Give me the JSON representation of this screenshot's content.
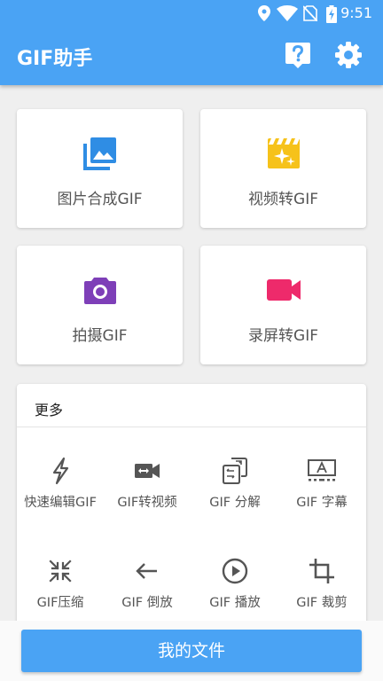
{
  "status_bar": {
    "time": "9:51",
    "icons": [
      "location-icon",
      "wifi-icon",
      "no-sim-icon",
      "battery-charging-icon"
    ]
  },
  "app_bar": {
    "title": "GIF助手",
    "help_icon": "help-icon",
    "settings_icon": "gear-icon"
  },
  "features": [
    {
      "label": "图片合成GIF",
      "icon": "photo-library-icon",
      "color": "#2f8de4"
    },
    {
      "label": "视频转GIF",
      "icon": "movie-clapper-icon",
      "color": "#f6c21a"
    },
    {
      "label": "拍摄GIF",
      "icon": "camera-icon",
      "color": "#7e3fb8"
    },
    {
      "label": "录屏转GIF",
      "icon": "video-camera-icon",
      "color": "#ee2a6b"
    }
  ],
  "more": {
    "title": "更多",
    "tools": [
      {
        "label": "快速编辑GIF",
        "icon": "flash-icon"
      },
      {
        "label": "GIF转视频",
        "icon": "video-convert-icon"
      },
      {
        "label": "GIF 分解",
        "icon": "split-icon"
      },
      {
        "label": "GIF 字幕",
        "icon": "subtitle-icon"
      },
      {
        "label": "GIF压缩",
        "icon": "compress-icon"
      },
      {
        "label": "GIF 倒放",
        "icon": "arrow-left-icon"
      },
      {
        "label": "GIF 播放",
        "icon": "play-circle-icon"
      },
      {
        "label": "GIF 裁剪",
        "icon": "crop-icon"
      }
    ]
  },
  "bottom": {
    "button_label": "我的文件"
  },
  "colors": {
    "primary": "#4aa3f4",
    "background": "#efefef",
    "icon_gray": "#555555"
  }
}
